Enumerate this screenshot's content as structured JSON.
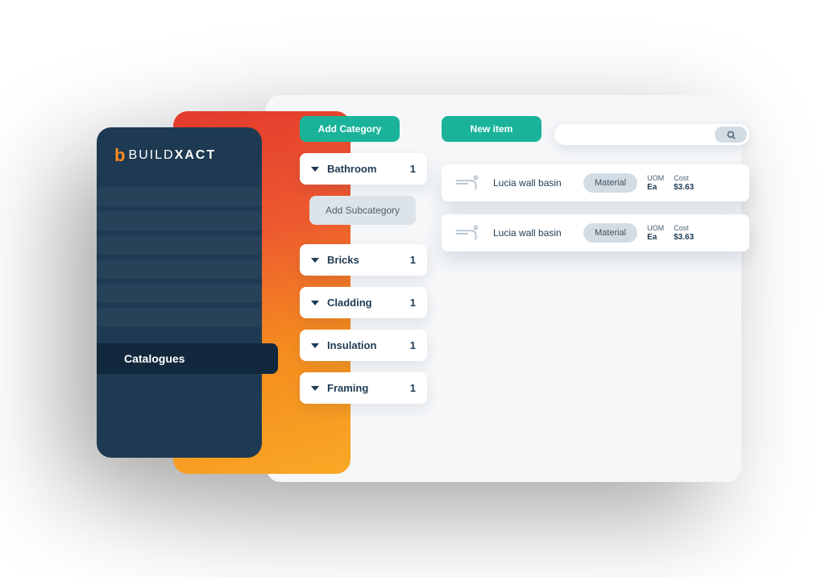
{
  "brand": {
    "prefix": "BUILD",
    "suffix": "XACT"
  },
  "sidebar": {
    "active_label": "Catalogues"
  },
  "buttons": {
    "add_category": "Add Category",
    "add_subcategory": "Add Subcategory",
    "new_item": "New item"
  },
  "categories": [
    {
      "name": "Bathroom",
      "count": "1"
    },
    {
      "name": "Bricks",
      "count": "1"
    },
    {
      "name": "Cladding",
      "count": "1"
    },
    {
      "name": "Insulation",
      "count": "1"
    },
    {
      "name": "Framing",
      "count": "1"
    }
  ],
  "labels": {
    "uom": "UOM",
    "cost": "Cost"
  },
  "items": [
    {
      "name": "Lucia wall basin",
      "type": "Material",
      "uom": "Ea",
      "cost": "$3.63"
    },
    {
      "name": "Lucia wall basin",
      "type": "Material",
      "uom": "Ea",
      "cost": "$3.63"
    }
  ]
}
